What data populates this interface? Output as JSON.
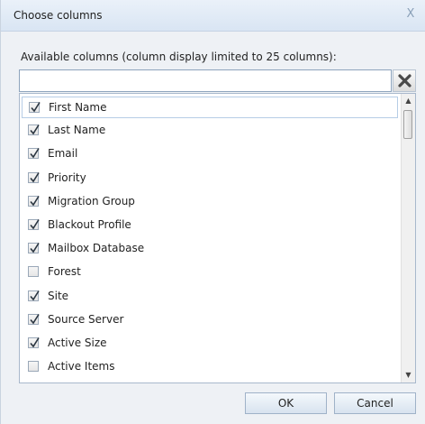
{
  "dialog": {
    "title": "Choose columns",
    "close_glyph": "X",
    "available_label": "Available columns (column display limited to 25 columns):",
    "search_value": "",
    "clear_icon": "clear-x-icon",
    "ok_label": "OK",
    "cancel_label": "Cancel"
  },
  "columns": [
    {
      "label": "First Name",
      "checked": true,
      "selected": true
    },
    {
      "label": "Last Name",
      "checked": true,
      "selected": false
    },
    {
      "label": "Email",
      "checked": true,
      "selected": false
    },
    {
      "label": "Priority",
      "checked": true,
      "selected": false
    },
    {
      "label": "Migration Group",
      "checked": true,
      "selected": false
    },
    {
      "label": "Blackout Profile",
      "checked": true,
      "selected": false
    },
    {
      "label": "Mailbox Database",
      "checked": true,
      "selected": false
    },
    {
      "label": "Forest",
      "checked": false,
      "selected": false
    },
    {
      "label": "Site",
      "checked": true,
      "selected": false
    },
    {
      "label": "Source Server",
      "checked": true,
      "selected": false
    },
    {
      "label": "Active Size",
      "checked": true,
      "selected": false
    },
    {
      "label": "Active Items",
      "checked": false,
      "selected": false
    }
  ],
  "scrollbar": {
    "up_glyph": "▲",
    "down_glyph": "▼"
  },
  "colors": {
    "titlebar": "#d9e5f3",
    "dialog_bg": "#eef1f5",
    "check": "#2a3540"
  }
}
